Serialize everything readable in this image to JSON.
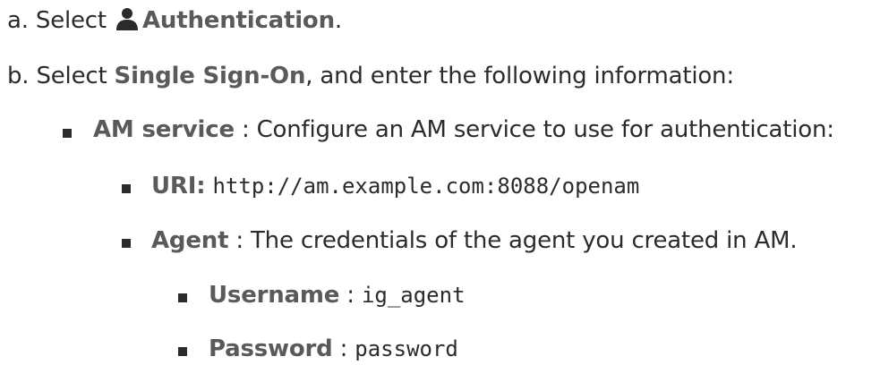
{
  "steps": {
    "a": {
      "marker": "a.",
      "prefix": "Select",
      "icon": "person-icon",
      "item": "Authentication",
      "suffix": "."
    },
    "b": {
      "marker": "b.",
      "prefix": "Select",
      "item": "Single Sign-On",
      "suffix": ", and enter the following information:"
    }
  },
  "am_service": {
    "label": "AM service",
    "text": " : Configure an AM service to use for authentication:"
  },
  "uri": {
    "label": "URI:",
    "value": "http://am.example.com:8088/openam"
  },
  "agent": {
    "label": "Agent",
    "text": " : The credentials of the agent you created in AM."
  },
  "username": {
    "label": "Username",
    "separator": " : ",
    "value": "ig_agent"
  },
  "password": {
    "label": "Password",
    "separator": " : ",
    "value": "password"
  }
}
